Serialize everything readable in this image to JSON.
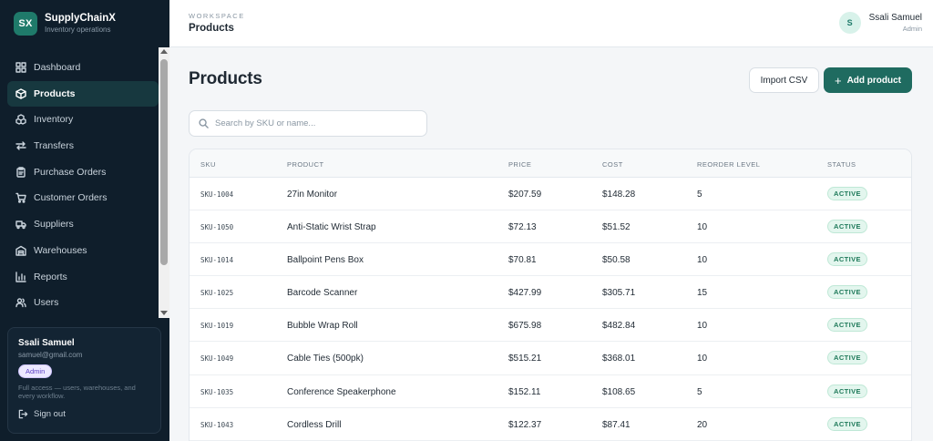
{
  "brand": {
    "logo": "SX",
    "name": "SupplyChainX",
    "subtitle": "Inventory operations"
  },
  "sidebar": {
    "items": [
      {
        "label": "Dashboard",
        "icon": "dashboard-icon"
      },
      {
        "label": "Products",
        "icon": "box-icon",
        "active": true
      },
      {
        "label": "Inventory",
        "icon": "inventory-icon"
      },
      {
        "label": "Transfers",
        "icon": "transfer-icon"
      },
      {
        "label": "Purchase Orders",
        "icon": "clipboard-icon"
      },
      {
        "label": "Customer Orders",
        "icon": "cart-icon"
      },
      {
        "label": "Suppliers",
        "icon": "truck-icon"
      },
      {
        "label": "Warehouses",
        "icon": "warehouse-icon"
      },
      {
        "label": "Reports",
        "icon": "chart-icon"
      },
      {
        "label": "Users",
        "icon": "users-icon"
      }
    ]
  },
  "user_card": {
    "name": "Ssali Samuel",
    "email": "samuel@gmail.com",
    "role": "Admin",
    "description": "Full access — users, warehouses, and every workflow.",
    "signout": "Sign out"
  },
  "topbar": {
    "eyebrow": "WORKSPACE",
    "title": "Products",
    "avatar": "S",
    "user_name": "Ssali Samuel",
    "user_role": "Admin"
  },
  "main": {
    "title": "Products",
    "import_label": "Import CSV",
    "add_label": "Add product",
    "search_placeholder": "Search by SKU or name..."
  },
  "table": {
    "headers": [
      "SKU",
      "PRODUCT",
      "PRICE",
      "COST",
      "REORDER LEVEL",
      "STATUS"
    ],
    "rows": [
      {
        "sku": "SKU-1004",
        "product": "27in Monitor",
        "price": "$207.59",
        "cost": "$148.28",
        "reorder": "5",
        "status": "ACTIVE"
      },
      {
        "sku": "SKU-1050",
        "product": "Anti-Static Wrist Strap",
        "price": "$72.13",
        "cost": "$51.52",
        "reorder": "10",
        "status": "ACTIVE"
      },
      {
        "sku": "SKU-1014",
        "product": "Ballpoint Pens Box",
        "price": "$70.81",
        "cost": "$50.58",
        "reorder": "10",
        "status": "ACTIVE"
      },
      {
        "sku": "SKU-1025",
        "product": "Barcode Scanner",
        "price": "$427.99",
        "cost": "$305.71",
        "reorder": "15",
        "status": "ACTIVE"
      },
      {
        "sku": "SKU-1019",
        "product": "Bubble Wrap Roll",
        "price": "$675.98",
        "cost": "$482.84",
        "reorder": "10",
        "status": "ACTIVE"
      },
      {
        "sku": "SKU-1049",
        "product": "Cable Ties (500pk)",
        "price": "$515.21",
        "cost": "$368.01",
        "reorder": "10",
        "status": "ACTIVE"
      },
      {
        "sku": "SKU-1035",
        "product": "Conference Speakerphone",
        "price": "$152.11",
        "cost": "$108.65",
        "reorder": "5",
        "status": "ACTIVE"
      },
      {
        "sku": "SKU-1043",
        "product": "Cordless Drill",
        "price": "$122.37",
        "cost": "$87.41",
        "reorder": "20",
        "status": "ACTIVE"
      }
    ]
  },
  "colors": {
    "sidebar_bg": "#0f1e2b",
    "accent": "#1f6b60",
    "active_nav": "#17383f",
    "status_green": "#1f7a5a"
  }
}
